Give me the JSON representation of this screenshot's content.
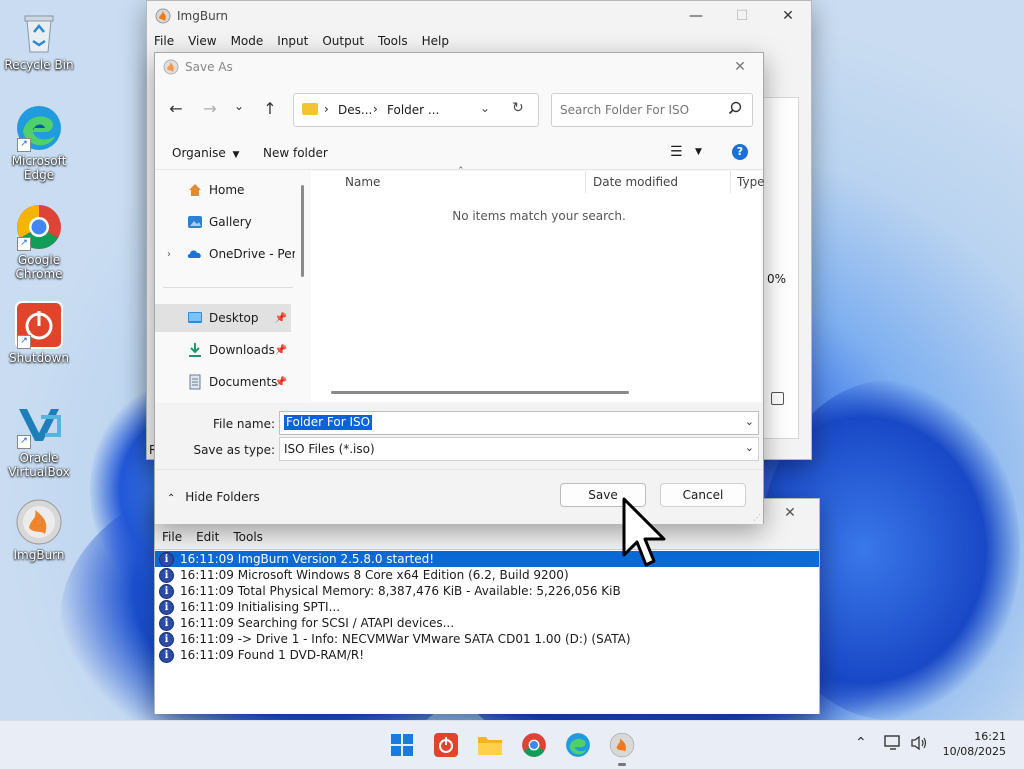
{
  "desktop": {
    "icons": [
      {
        "label": "Recycle Bin"
      },
      {
        "label": "Microsoft Edge"
      },
      {
        "label": "Google Chrome"
      },
      {
        "label": "Shutdown"
      },
      {
        "label": "Oracle VirtualBox"
      },
      {
        "label": "ImgBurn"
      }
    ]
  },
  "imgburn": {
    "title": "ImgBurn",
    "menu": [
      "File",
      "View",
      "Mode",
      "Input",
      "Output",
      "Tools",
      "Help"
    ],
    "percent": "0%",
    "letter": "R"
  },
  "log": {
    "menu": [
      "File",
      "Edit",
      "Tools"
    ],
    "lines": [
      "16:11:09 ImgBurn Version 2.5.8.0 started!",
      "16:11:09 Microsoft Windows 8 Core x64 Edition (6.2, Build 9200)",
      "16:11:09 Total Physical Memory: 8,387,476 KiB  -  Available: 5,226,056 KiB",
      "16:11:09 Initialising SPTI...",
      "16:11:09 Searching for SCSI / ATAPI devices...",
      "16:11:09 -> Drive 1 - Info: NECVMWar VMware SATA CD01 1.00 (D:) (SATA)",
      "16:11:09 Found 1 DVD-RAM/R!"
    ]
  },
  "dialog": {
    "title": "Save As",
    "breadcrumb": [
      "Des...",
      "Folder ..."
    ],
    "search_placeholder": "Search Folder For ISO",
    "organise_label": "Organise",
    "new_folder_label": "New folder",
    "nav": [
      {
        "label": "Home"
      },
      {
        "label": "Gallery"
      },
      {
        "label": "OneDrive - Perso"
      },
      {
        "label": "Desktop"
      },
      {
        "label": "Downloads"
      },
      {
        "label": "Documents"
      }
    ],
    "columns": [
      "Name",
      "Date modified",
      "Type"
    ],
    "empty_message": "No items match your search.",
    "file_name_label": "File name:",
    "file_name_value": "Folder For ISO",
    "save_type_label": "Save as type:",
    "save_type_value": "ISO Files (*.iso)",
    "hide_folders_label": "Hide Folders",
    "save_label": "Save",
    "cancel_label": "Cancel"
  },
  "taskbar": {
    "time": "16:21",
    "date": "10/08/2025"
  },
  "colors": {
    "accent": "#0067c0",
    "selection": "#0a64d8",
    "imgburn_log_highlight": "#0a6ad6"
  }
}
